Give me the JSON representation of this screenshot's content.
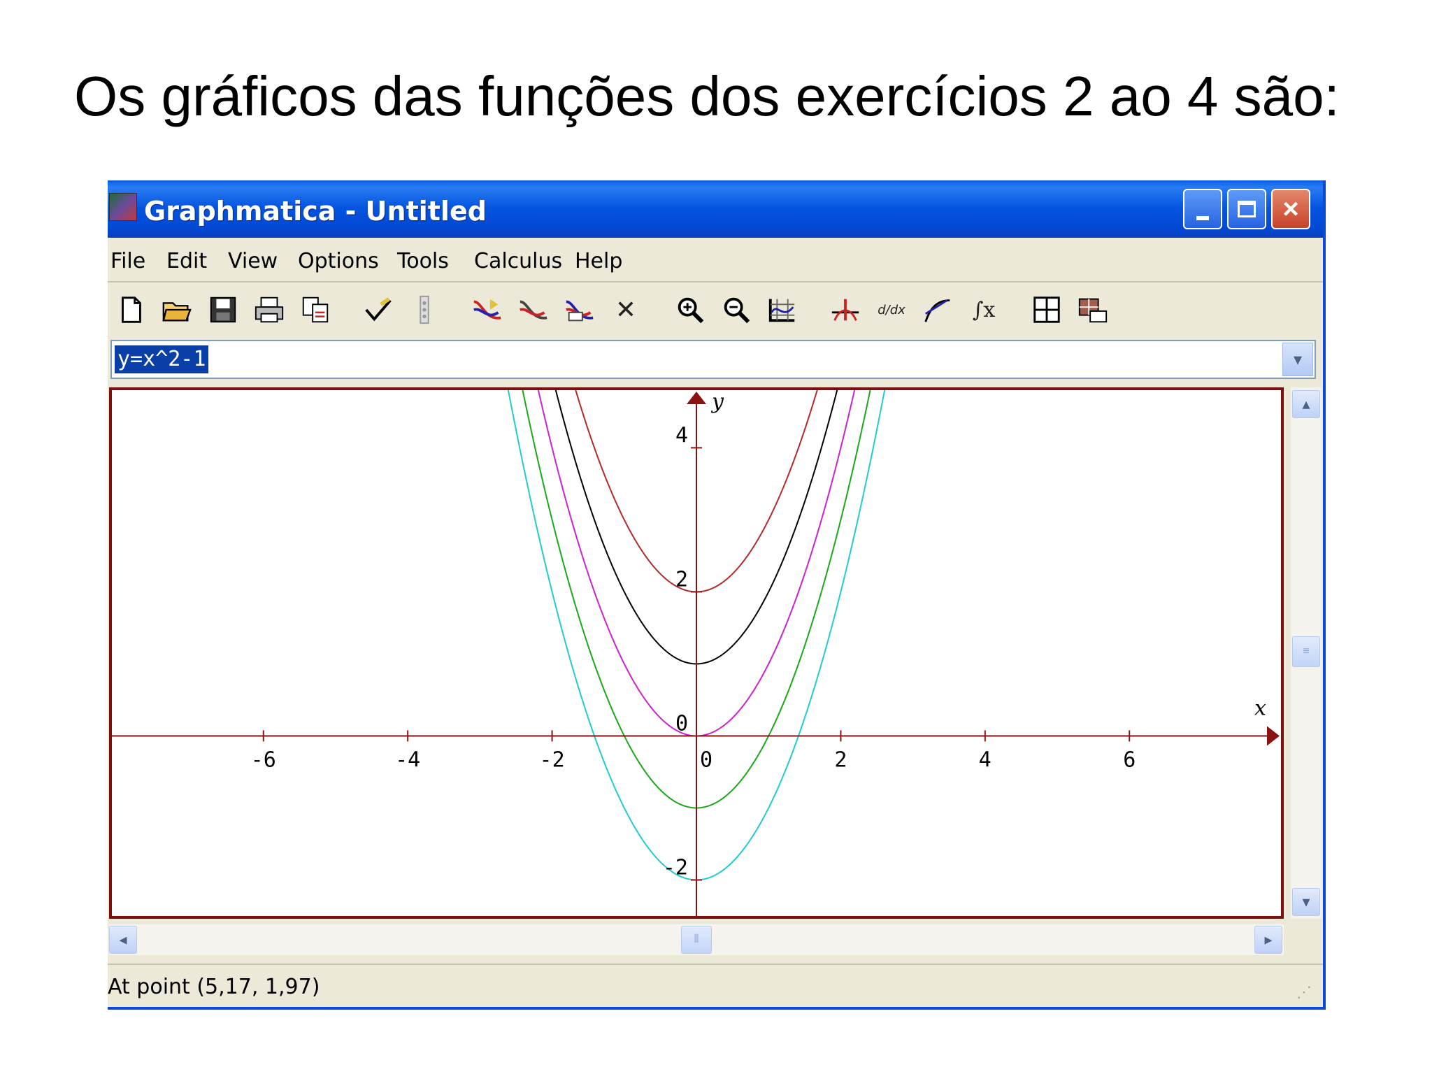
{
  "slide": {
    "title": "Os gráficos das funções dos exercícios 2 ao 4 são:"
  },
  "window": {
    "title": "Graphmatica - Untitled",
    "controls": {
      "close_label": "×"
    }
  },
  "menu": [
    "File",
    "Edit",
    "View",
    "Options",
    "Tools",
    "Calculus",
    "Help"
  ],
  "toolbar": {
    "icons": [
      "new-file-icon",
      "open-folder-icon",
      "save-icon",
      "print-icon",
      "copy-icon",
      "check-icon",
      "grip-icon",
      "plot-icon",
      "redraw-icon",
      "erase-graph-icon",
      "delete-icon",
      "zoom-in-icon",
      "zoom-out-icon",
      "grid-icon",
      "roots-icon",
      "derivative-icon",
      "tangent-icon",
      "integral-icon",
      "table-icon",
      "coordinates-icon"
    ],
    "delete_glyph": "✕",
    "integral_glyph": "∫x",
    "derivative_glyph": "d/dx"
  },
  "equation": {
    "value": "y=x^2-1"
  },
  "status": {
    "text": "At point (5,17, 1,97)"
  },
  "colors": {
    "axis": "#8b1212",
    "frame": "#7a1010",
    "title_bar": "#0454e0"
  },
  "chart_data": {
    "type": "line",
    "xlabel": "x",
    "ylabel": "y",
    "xlim": [
      -8.1,
      8.1
    ],
    "ylim": [
      -2.5,
      4.8
    ],
    "x_ticks": [
      -6,
      -4,
      -2,
      0,
      2,
      4,
      6
    ],
    "x_tick_labels": [
      "-6",
      "-4",
      "-2",
      "0",
      "2",
      "4",
      "6"
    ],
    "y_ticks": [
      -2,
      0,
      2,
      4
    ],
    "y_tick_labels": [
      "-2",
      "0",
      "2",
      "4"
    ],
    "series": [
      {
        "color": "#b22a2a",
        "a": 1,
        "c": 2
      },
      {
        "color": "#000000",
        "a": 1,
        "c": 1
      },
      {
        "color": "#cc22cc",
        "a": 1,
        "c": 0
      },
      {
        "color": "#1aa81a",
        "a": 1,
        "c": -1
      },
      {
        "color": "#22cccc",
        "a": 1,
        "c": -2
      }
    ]
  }
}
